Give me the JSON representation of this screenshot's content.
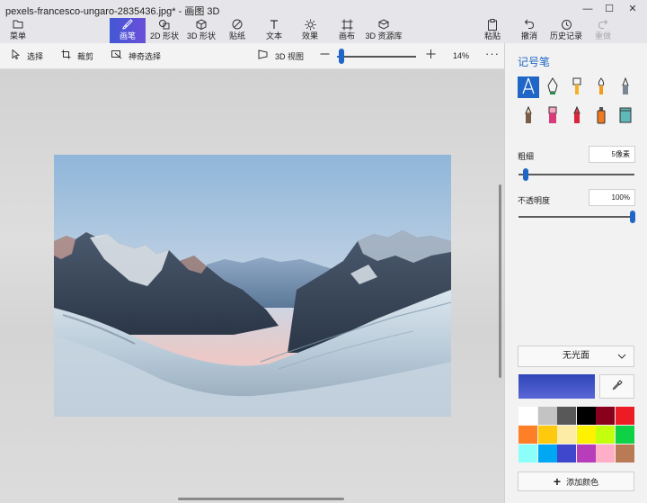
{
  "window": {
    "title": "pexels-francesco-ungaro-2835436.jpg* - 画图 3D",
    "minimize": "—",
    "maximize": "☐",
    "close": "✕"
  },
  "ribbon": {
    "menu": "菜单",
    "brushes": "画笔",
    "shapes_2d": "2D 形状",
    "shapes_3d": "3D 形状",
    "stickers": "贴纸",
    "text": "文本",
    "effects": "效果",
    "canvas": "画布",
    "library_3d": "3D 资源库",
    "paste": "粘贴",
    "undo": "撤消",
    "history": "历史记录",
    "redo": "重做"
  },
  "toolbar": {
    "select": "选择",
    "crop": "裁剪",
    "magic_select": "神奇选择",
    "view_3d": "3D 视图",
    "zoom_percent": "14%",
    "more": "···"
  },
  "zoom": {
    "level_fraction": 0.06
  },
  "panel": {
    "title": "记号笔",
    "brushes": [
      {
        "name": "marker",
        "selected": true
      },
      {
        "name": "calligraphy-pen"
      },
      {
        "name": "oil-brush"
      },
      {
        "name": "watercolor"
      },
      {
        "name": "pixel-pen"
      },
      {
        "name": "pencil"
      },
      {
        "name": "eraser"
      },
      {
        "name": "crayon"
      },
      {
        "name": "spray-can"
      },
      {
        "name": "fill"
      }
    ],
    "thickness_label": "粗细",
    "thickness_value": "5像素",
    "thickness_fraction": 0.05,
    "opacity_label": "不透明度",
    "opacity_value": "100%",
    "opacity_fraction": 1.0,
    "finish": "无光面",
    "add_color": "添加颜色",
    "swatches": [
      "#ffffff",
      "#c3c3c3",
      "#585858",
      "#000000",
      "#88001b",
      "#ec1c24",
      "#ff7f27",
      "#ffc90e",
      "#fdeca6",
      "#fff200",
      "#c4ff0e",
      "#0ed145",
      "#8cfffb",
      "#00a8f3",
      "#3f48cc",
      "#b83dba",
      "#ffaec8",
      "#b97a56"
    ],
    "accent": "#1f66c6"
  }
}
